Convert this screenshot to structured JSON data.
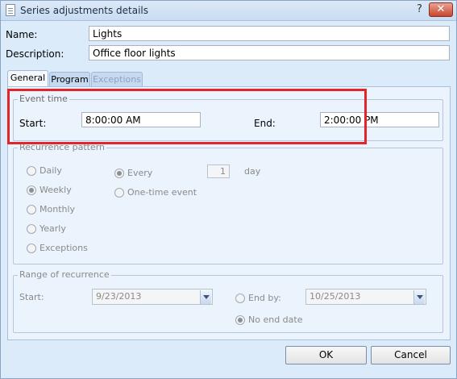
{
  "window": {
    "title": "Series adjustments details",
    "help_glyph": "?",
    "close_glyph": "✕"
  },
  "form": {
    "name_label": "Name:",
    "name_value": "Lights",
    "description_label": "Description:",
    "description_value": "Office floor lights"
  },
  "tabs": [
    {
      "label": "General",
      "state": "active"
    },
    {
      "label": "Program",
      "state": "normal"
    },
    {
      "label": "Exceptions",
      "state": "disabled"
    }
  ],
  "event_time": {
    "title": "Event time",
    "start_label": "Start:",
    "start_value": "8:00:00 AM",
    "end_label": "End:",
    "end_value": "2:00:00 PM"
  },
  "recurrence_pattern": {
    "title": "Recurrence pattern",
    "options": [
      "Daily",
      "Weekly",
      "Monthly",
      "Yearly",
      "Exceptions"
    ],
    "selected": "Weekly",
    "every_label": "Every",
    "every_value": "1",
    "every_unit": "day",
    "one_time_label": "One-time event"
  },
  "range_of_recurrence": {
    "title": "Range of recurrence",
    "start_label": "Start:",
    "start_value": "9/23/2013",
    "end_by_label": "End by:",
    "end_by_value": "10/25/2013",
    "no_end_label": "No end date"
  },
  "buttons": {
    "ok": "OK",
    "cancel": "Cancel"
  },
  "colors": {
    "highlight": "#e3242b",
    "window_bg": "#dcebf9"
  }
}
